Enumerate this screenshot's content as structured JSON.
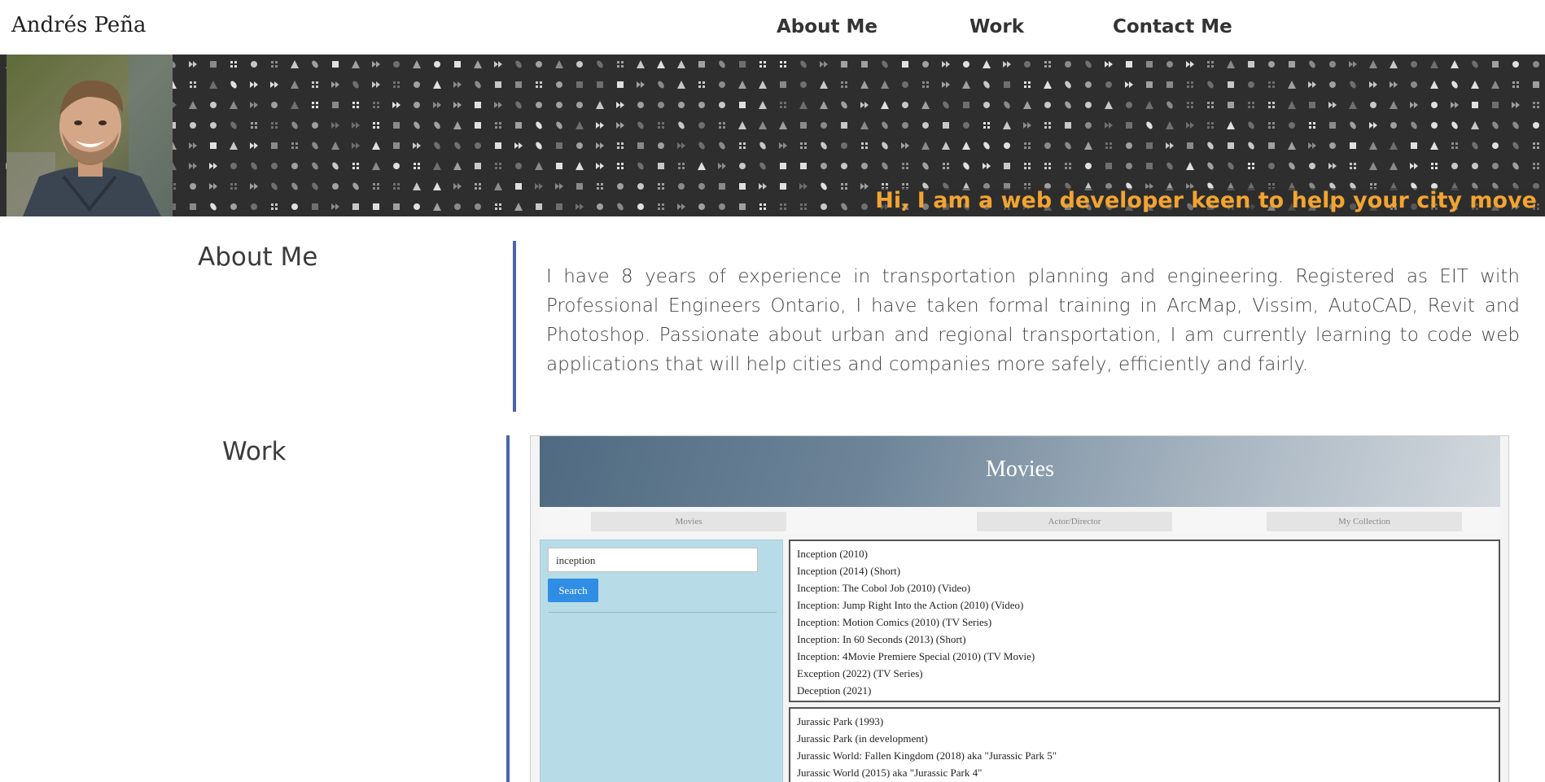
{
  "brand": "Andrés Peña",
  "nav": [
    {
      "label": "About Me"
    },
    {
      "label": "Work"
    },
    {
      "label": "Contact Me"
    }
  ],
  "banner": {
    "tagline": "Hi, I am a web developer keen to help your city move",
    "accent_color": "#f2a431",
    "portrait_icon": "person-portrait"
  },
  "about": {
    "title": "About Me",
    "text": "I have 8 years of experience in transportation planning and engineering. Registered as EIT with Professional Engineers Ontario, I have taken formal training in ArcMap, Vissim, AutoCAD, Revit and Photoshop. Passionate about urban and regional transportation, I am currently learning to code web applications that will help cities and companies more safely, efficiently and fairly."
  },
  "work": {
    "title": "Work",
    "project": {
      "title": "Movies",
      "tabs": [
        "Movies",
        "Actor/Director",
        "My Collection"
      ],
      "search_value": "inception",
      "search_button": "Search",
      "results_1": [
        "Inception (2010)",
        "Inception (2014) (Short)",
        "Inception: The Cobol Job (2010) (Video)",
        "Inception: Jump Right Into the Action (2010) (Video)",
        "Inception: Motion Comics (2010) (TV Series)",
        "Inception: In 60 Seconds (2013) (Short)",
        "Inception: 4Movie Premiere Special (2010) (TV Movie)",
        "Exception (2022) (TV Series)",
        "Deception (2021)"
      ],
      "results_2": [
        "Jurassic Park (1993)",
        "Jurassic Park (in development)",
        "Jurassic World: Fallen Kingdom (2018) aka \"Jurassic Park 5\"",
        "Jurassic World (2015) aka \"Jurassic Park 4\""
      ]
    }
  }
}
